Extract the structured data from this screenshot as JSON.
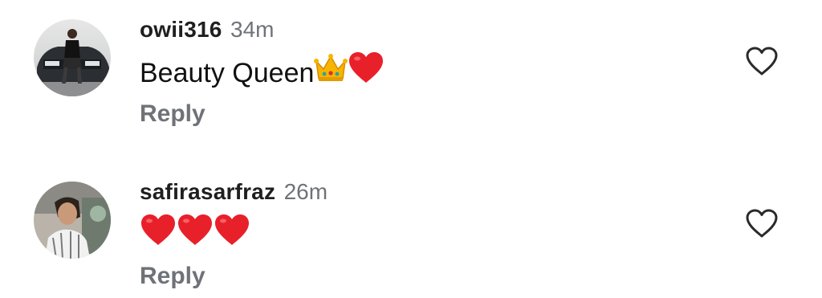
{
  "comments": [
    {
      "username": "owii316",
      "time": "34m",
      "text": "Beauty Queen",
      "emojis": [
        "crown-emoji",
        "red-heart-emoji"
      ],
      "reply_label": "Reply",
      "like_icon": "heart-outline-icon"
    },
    {
      "username": "safirasarfraz",
      "time": "26m",
      "text": "",
      "emojis": [
        "red-heart-emoji",
        "red-heart-emoji",
        "red-heart-emoji"
      ],
      "reply_label": "Reply",
      "like_icon": "heart-outline-icon"
    }
  ],
  "colors": {
    "username": "#1f1f1f",
    "meta": "#6f7378",
    "heart": "#e8202a",
    "crown": "#f7b500"
  }
}
